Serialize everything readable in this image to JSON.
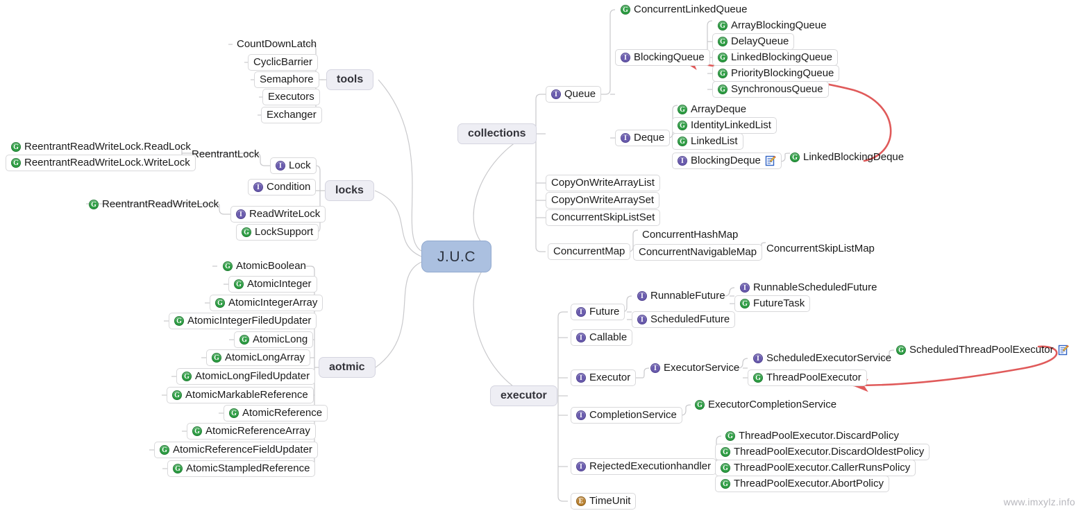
{
  "watermark": "www.imxylz.info",
  "colors": {
    "root_fill": "#abc0e0",
    "category_fill": "#eeeef4",
    "class_icon": "#2e9e44",
    "interface_icon": "#6a5cad",
    "enum_icon": "#b98130",
    "arrow": "#e05a5a",
    "edge": "#c9c9cc"
  },
  "root": {
    "label": "J.U.C"
  },
  "categories": {
    "tools": "tools",
    "locks": "locks",
    "atomic": "aotmic",
    "collections": "collections",
    "executor": "executor"
  },
  "tools": {
    "items": [
      {
        "label": "CountDownLatch",
        "icon": "none"
      },
      {
        "label": "CyclicBarrier",
        "icon": "none"
      },
      {
        "label": "Semaphore",
        "icon": "none"
      },
      {
        "label": "Executors",
        "icon": "none"
      },
      {
        "label": "Exchanger",
        "icon": "none"
      }
    ]
  },
  "locks": {
    "items": [
      {
        "label": "Lock",
        "icon": "interface"
      },
      {
        "label": "Condition",
        "icon": "interface"
      },
      {
        "label": "ReadWriteLock",
        "icon": "interface"
      },
      {
        "label": "LockSupport",
        "icon": "class"
      }
    ],
    "lock_children": [
      {
        "label": "ReentrantLock",
        "icon": "none"
      },
      {
        "label": "ReentrantReadWriteLock.ReadLock",
        "icon": "class"
      },
      {
        "label": "ReentrantReadWriteLock.WriteLock",
        "icon": "class"
      }
    ],
    "readwritelock_children": [
      {
        "label": "ReentrantReadWriteLock",
        "icon": "class"
      }
    ]
  },
  "atomic": {
    "items": [
      {
        "label": "AtomicBoolean",
        "icon": "class"
      },
      {
        "label": "AtomicInteger",
        "icon": "class"
      },
      {
        "label": "AtomicIntegerArray",
        "icon": "class"
      },
      {
        "label": "AtomicIntegerFiledUpdater",
        "icon": "class"
      },
      {
        "label": "AtomicLong",
        "icon": "class"
      },
      {
        "label": "AtomicLongArray",
        "icon": "class"
      },
      {
        "label": "AtomicLongFiledUpdater",
        "icon": "class"
      },
      {
        "label": "AtomicMarkableReference",
        "icon": "class"
      },
      {
        "label": "AtomicReference",
        "icon": "class"
      },
      {
        "label": "AtomicReferenceArray",
        "icon": "class"
      },
      {
        "label": "AtomicReferenceFieldUpdater",
        "icon": "class"
      },
      {
        "label": "AtomicStampledReference",
        "icon": "class"
      }
    ]
  },
  "collections": {
    "queue": {
      "label": "Queue",
      "icon": "interface"
    },
    "queue_children": [
      {
        "label": "ConcurrentLinkedQueue",
        "icon": "class"
      },
      {
        "label": "BlockingQueue",
        "icon": "interface"
      }
    ],
    "blockingqueue_children": [
      {
        "label": "ArrayBlockingQueue",
        "icon": "class"
      },
      {
        "label": "DelayQueue",
        "icon": "class"
      },
      {
        "label": "LinkedBlockingQueue",
        "icon": "class"
      },
      {
        "label": "PriorityBlockingQueue",
        "icon": "class"
      },
      {
        "label": "SynchronousQueue",
        "icon": "class"
      }
    ],
    "deque": {
      "label": "Deque",
      "icon": "interface"
    },
    "deque_children": [
      {
        "label": "ArrayDeque",
        "icon": "class"
      },
      {
        "label": "IdentityLinkedList",
        "icon": "class"
      },
      {
        "label": "LinkedList",
        "icon": "class"
      },
      {
        "label": "BlockingDeque",
        "icon": "interface",
        "note": true
      }
    ],
    "blockingdeque_children": [
      {
        "label": "LinkedBlockingDeque",
        "icon": "class"
      }
    ],
    "lists": [
      {
        "label": "CopyOnWriteArrayList",
        "icon": "none"
      },
      {
        "label": "CopyOnWriteArraySet",
        "icon": "none"
      },
      {
        "label": "ConcurrentSkipListSet",
        "icon": "none"
      }
    ],
    "concurrent_map": {
      "label": "ConcurrentMap",
      "icon": "none"
    },
    "concurrent_map_children": [
      {
        "label": "ConcurrentHashMap",
        "icon": "none"
      },
      {
        "label": "ConcurrentNavigableMap",
        "icon": "none"
      }
    ],
    "navigable_map_children": [
      {
        "label": "ConcurrentSkipListMap",
        "icon": "none"
      }
    ]
  },
  "executor": {
    "items": [
      {
        "label": "Future",
        "icon": "interface"
      },
      {
        "label": "Callable",
        "icon": "interface"
      },
      {
        "label": "Executor",
        "icon": "interface"
      },
      {
        "label": "CompletionService",
        "icon": "interface"
      },
      {
        "label": "RejectedExecutionhandler",
        "icon": "interface"
      },
      {
        "label": "TimeUnit",
        "icon": "enum"
      }
    ],
    "future_children": [
      {
        "label": "RunnableFuture",
        "icon": "interface"
      },
      {
        "label": "ScheduledFuture",
        "icon": "interface"
      }
    ],
    "runnablefuture_children": [
      {
        "label": "RunnableScheduledFuture",
        "icon": "interface"
      },
      {
        "label": "FutureTask",
        "icon": "class"
      }
    ],
    "executor_children": [
      {
        "label": "ExecutorService",
        "icon": "interface"
      }
    ],
    "executorservice_children": [
      {
        "label": "ScheduledExecutorService",
        "icon": "interface"
      },
      {
        "label": "ThreadPoolExecutor",
        "icon": "class"
      }
    ],
    "scheduledexecutorservice_children": [
      {
        "label": "ScheduledThreadPoolExecutor",
        "icon": "class",
        "note": true
      }
    ],
    "completionservice_children": [
      {
        "label": "ExecutorCompletionService",
        "icon": "class"
      }
    ],
    "rejected_children": [
      {
        "label": "ThreadPoolExecutor.DiscardPolicy",
        "icon": "class"
      },
      {
        "label": "ThreadPoolExecutor.DiscardOldestPolicy",
        "icon": "class"
      },
      {
        "label": "ThreadPoolExecutor.CallerRunsPolicy",
        "icon": "class"
      },
      {
        "label": "ThreadPoolExecutor.AbortPolicy",
        "icon": "class"
      }
    ]
  },
  "annotations": [
    {
      "name": "arrow-linkedblockingdeque-to-blockingqueue"
    },
    {
      "name": "arrow-scheduledthreadpoolexecutor-to-threadpoolexecutor"
    }
  ]
}
